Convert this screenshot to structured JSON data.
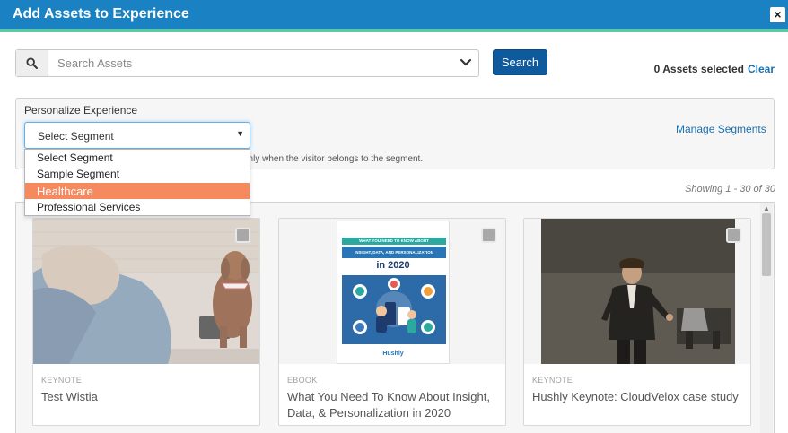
{
  "header": {
    "title": "Add Assets to Experience",
    "close_label": "×"
  },
  "search": {
    "placeholder": "Search Assets",
    "button_label": "Search"
  },
  "selection": {
    "count_text": "0 Assets selected",
    "clear_label": "Clear"
  },
  "personalize": {
    "label": "Personalize Experience",
    "selected_value": "Select Segment",
    "manage_link": "Manage Segments",
    "help_text": "only when the visitor belongs to the segment.",
    "options": [
      "Select Segment",
      "Sample Segment",
      "Healthcare",
      "Professional Services"
    ],
    "highlighted_option": "Healthcare"
  },
  "results": {
    "showing_text": "Showing 1 - 30 of 30"
  },
  "assets": [
    {
      "type": "KEYNOTE",
      "title": "Test Wistia"
    },
    {
      "type": "EBOOK",
      "title": "What You Need To Know About Insight, Data, & Personalization in 2020",
      "cover": {
        "band1": "WHAT YOU NEED TO KNOW ABOUT",
        "band2": "INSIGHT, DATA, AND PERSONALIZATION",
        "year": "in 2020",
        "logo": "Hushly"
      }
    },
    {
      "type": "KEYNOTE",
      "title": "Hushly Keynote: CloudVelox case study"
    }
  ],
  "colors": {
    "header": "#1a82c3",
    "accent": "#5cc9a7",
    "primary_button": "#0e5a9c",
    "highlight": "#f58a5f",
    "link": "#1a6fb0"
  }
}
